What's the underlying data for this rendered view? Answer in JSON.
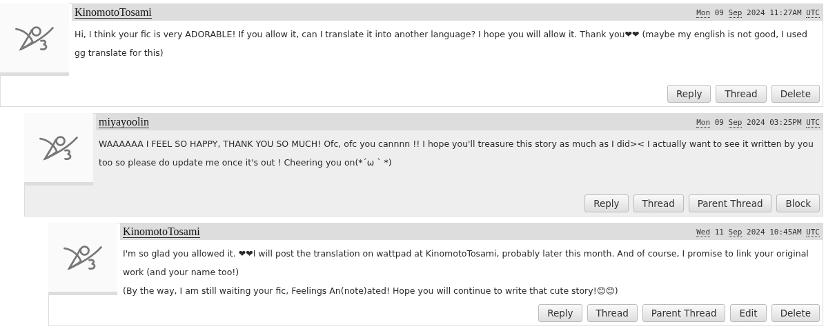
{
  "comments": [
    {
      "author": "KinomotoTosami",
      "timestamp": {
        "weekday": "Mon",
        "day": "09",
        "month": "Sep",
        "year": "2024",
        "time": "11:27AM",
        "zone": "UTC"
      },
      "paragraphs": [
        "Hi, I think your fic is very ADORABLE! If you allow it, can I translate it into another language? I hope you will allow it. Thank you❤❤ (maybe my english is not good, I used gg translate for this)"
      ],
      "actions": [
        "Reply",
        "Thread",
        "Delete"
      ],
      "children": [
        {
          "author": "miyayoolin",
          "timestamp": {
            "weekday": "Mon",
            "day": "09",
            "month": "Sep",
            "year": "2024",
            "time": "03:25PM",
            "zone": "UTC"
          },
          "paragraphs": [
            "WAAAAAA I FEEL SO HAPPY, THANK YOU SO MUCH! Ofc, ofc you cannnn !! I hope you'll treasure this story as much as I did>< I actually want to see it written by you too so please do update me once it's out ! Cheering you on(*´ω ` *)"
          ],
          "actions": [
            "Reply",
            "Thread",
            "Parent Thread",
            "Block"
          ],
          "children": [
            {
              "author": "KinomotoTosami",
              "timestamp": {
                "weekday": "Wed",
                "day": "11",
                "month": "Sep",
                "year": "2024",
                "time": "10:45AM",
                "zone": "UTC"
              },
              "paragraphs": [
                "I'm so glad you allowed it. ❤❤I will post the translation on wattpad at KinomotoTosami, probably later this month. And of course, I promise to link your original work (and your name too!)",
                "(By the way, I am still waiting your fic, Feelings An(note)ated! Hope you will continue to write that cute story!😊😊)"
              ],
              "actions": [
                "Reply",
                "Thread",
                "Parent Thread",
                "Edit",
                "Delete"
              ]
            }
          ]
        }
      ]
    }
  ]
}
